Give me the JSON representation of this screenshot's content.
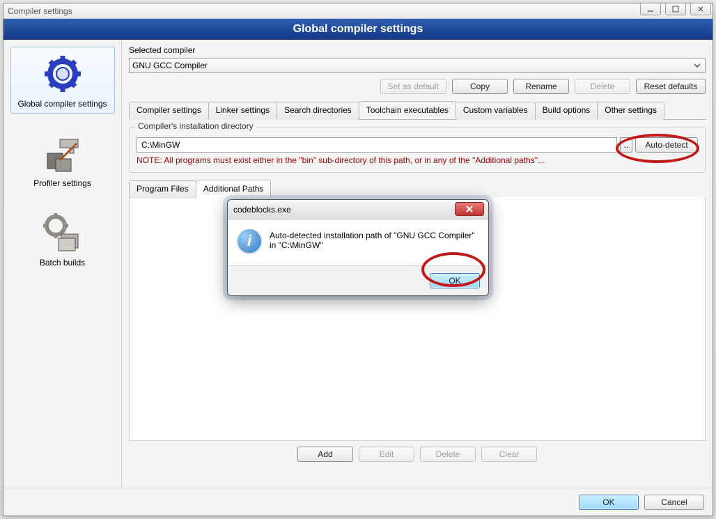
{
  "window": {
    "title": "Compiler settings"
  },
  "banner": "Global compiler settings",
  "sidebar": {
    "items": [
      {
        "label": "Global compiler settings"
      },
      {
        "label": "Profiler settings"
      },
      {
        "label": "Batch builds"
      }
    ]
  },
  "selected_compiler_label": "Selected compiler",
  "selected_compiler_value": "GNU GCC Compiler",
  "compiler_buttons": {
    "set_default": "Set as default",
    "copy": "Copy",
    "rename": "Rename",
    "delete": "Delete",
    "reset": "Reset defaults"
  },
  "tabs": [
    "Compiler settings",
    "Linker settings",
    "Search directories",
    "Toolchain executables",
    "Custom variables",
    "Build options",
    "Other settings"
  ],
  "active_tab_index": 3,
  "install_dir": {
    "legend": "Compiler's installation directory",
    "path": "C:\\MinGW",
    "browse": "..",
    "auto_detect": "Auto-detect",
    "note": "NOTE: All programs must exist either in the \"bin\" sub-directory of this path, or in any of the \"Additional paths\"..."
  },
  "subtabs": [
    "Program Files",
    "Additional Paths"
  ],
  "active_subtab_index": 1,
  "path_buttons": {
    "add": "Add",
    "edit": "Edit",
    "delete": "Delete",
    "clear": "Clear"
  },
  "footer": {
    "ok": "OK",
    "cancel": "Cancel"
  },
  "dialog": {
    "title": "codeblocks.exe",
    "message": "Auto-detected installation path of \"GNU GCC Compiler\" in \"C:\\MinGW\"",
    "ok": "OK"
  }
}
